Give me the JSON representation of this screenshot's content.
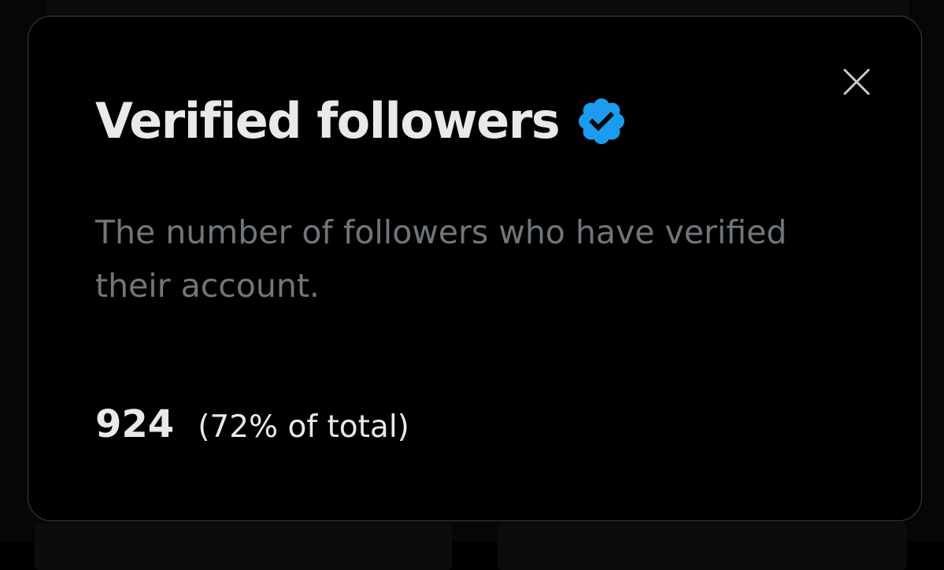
{
  "modal": {
    "title": "Verified followers",
    "badge_icon": "verified-badge-icon",
    "badge_color": "#1d9bf0",
    "close_icon": "close-icon",
    "description": "The number of followers who have verified their account.",
    "stat": {
      "count": "924",
      "percentage_text": "(72% of total)"
    }
  }
}
